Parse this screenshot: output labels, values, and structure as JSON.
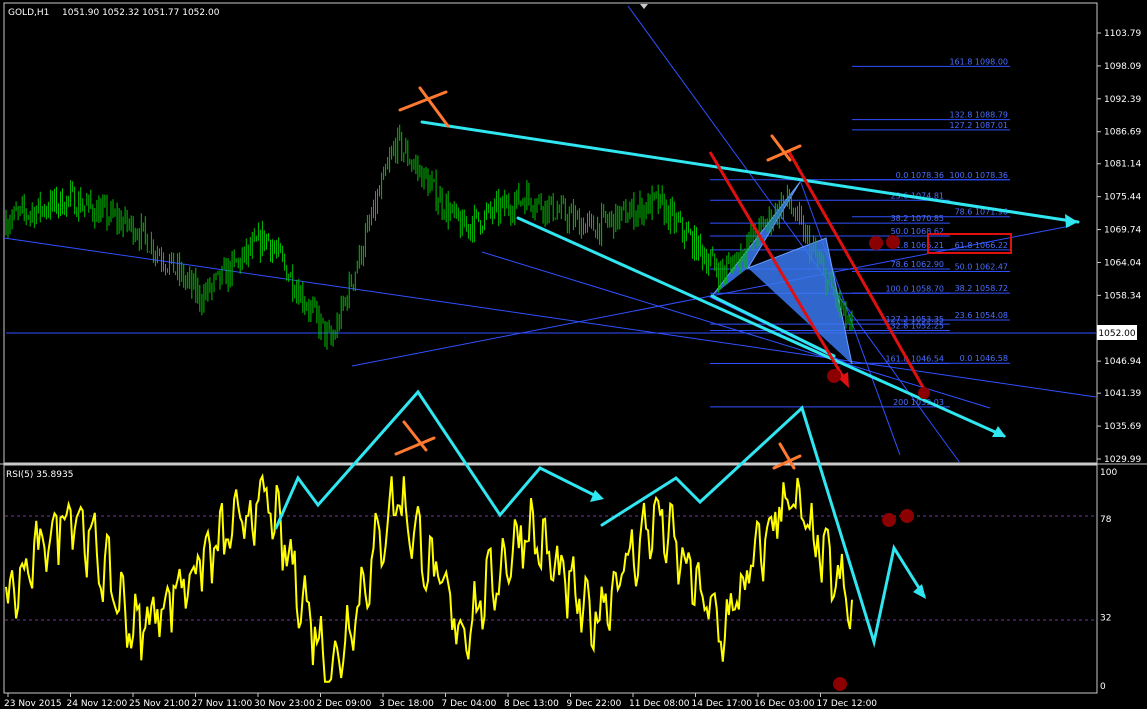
{
  "header": {
    "symbol": "GOLD,H1",
    "ohlc": "1051.90 1052.32 1051.77 1052.00"
  },
  "rsi": {
    "label": "RSI(5) 35.8935",
    "levels": [
      "100",
      "78",
      "32",
      "0"
    ]
  },
  "colors": {
    "background": "#000000",
    "candles": "#00C000",
    "rsi_line": "#FFFF00",
    "trendlines": "#3050FF",
    "cyan_lines": "#30E6F0",
    "red_lines": "#E01010",
    "fib_labels": "#4A6EFF",
    "pattern_fill": "#3A78F0",
    "marker_dots": "#8B0000",
    "orange_marks": "#FF7A30",
    "current_price_box": "#FFFFFF",
    "rsi_levels": "#5A2A8C",
    "axis_text": "#FFFFFF",
    "highlight_box": "#E01010"
  },
  "chart_data": [
    {
      "type": "candlestick",
      "title": "GOLD,H1",
      "y_ticks": [
        "1103.79",
        "1098.09",
        "1092.39",
        "1086.69",
        "1081.14",
        "1075.44",
        "1069.74",
        "1064.04",
        "1058.34",
        "1052.00",
        "1046.94",
        "1041.39",
        "1035.69",
        "1029.99"
      ],
      "current_price": "1052.00",
      "x_ticks": [
        "23 Nov 2015",
        "24 Nov 12:00",
        "25 Nov 21:00",
        "27 Nov 11:00",
        "30 Nov 23:00",
        "2 Dec 09:00",
        "3 Dec 18:00",
        "7 Dec 04:00",
        "8 Dec 13:00",
        "9 Dec 22:00",
        "11 Dec 08:00",
        "14 Dec 17:00",
        "16 Dec 03:00",
        "17 Dec 12:00"
      ],
      "ylim": [
        1029.0,
        1106.0
      ],
      "approx_close_path": [
        {
          "x": "23 Nov 2015",
          "y": 1071.5
        },
        {
          "x": "24 Nov 12:00",
          "y": 1075.0
        },
        {
          "x": "25 Nov 21:00",
          "y": 1070.0
        },
        {
          "x": "27 Nov 11:00",
          "y": 1058.0
        },
        {
          "x": "30 Nov 23:00",
          "y": 1068.5
        },
        {
          "x": "2 Dec 09:00",
          "y": 1050.0
        },
        {
          "x": "3 Dec 18:00",
          "y": 1085.0
        },
        {
          "x": "7 Dec 04:00",
          "y": 1070.0
        },
        {
          "x": "8 Dec 13:00",
          "y": 1075.5
        },
        {
          "x": "9 Dec 22:00",
          "y": 1070.0
        },
        {
          "x": "11 Dec 08:00",
          "y": 1074.5
        },
        {
          "x": "14 Dec 17:00",
          "y": 1062.0
        },
        {
          "x": "16 Dec 03:00",
          "y": 1075.0
        },
        {
          "x": "17 Dec 12:00",
          "y": 1052.0
        }
      ],
      "fib_levels": [
        {
          "label": "161.8 1098.00"
        },
        {
          "label": "132.8 1088.79"
        },
        {
          "label": "127.2 1087.01"
        },
        {
          "label": "0.0 1078.36"
        },
        {
          "label": "100.0 1078.36"
        },
        {
          "label": "23.6 1074.81"
        },
        {
          "label": "78.6 1071.96"
        },
        {
          "label": "38.2 1070.85"
        },
        {
          "label": "50.0 1068.62"
        },
        {
          "label": "61.8 1066.21"
        },
        {
          "label": "61.8 1066.22"
        },
        {
          "label": "78.6 1062.90"
        },
        {
          "label": "50.0 1062.47"
        },
        {
          "label": "100.0 1058.70"
        },
        {
          "label": "38.2 1058.72"
        },
        {
          "label": "127.2 1053.35"
        },
        {
          "label": "23.6 1054.08"
        },
        {
          "label": "132.8 1052.25"
        },
        {
          "label": "161.8 1046.54"
        },
        {
          "label": "0.0 1046.58"
        },
        {
          "label": "200 1039.03"
        }
      ]
    },
    {
      "type": "line",
      "title": "RSI(5) 35.8935",
      "ylim": [
        0,
        100
      ],
      "levels": [
        78,
        32
      ],
      "approx_values": [
        {
          "x": "23 Nov 2015",
          "y": 38
        },
        {
          "x": "24 Nov 12:00",
          "y": 85
        },
        {
          "x": "25 Nov 21:00",
          "y": 25
        },
        {
          "x": "27 Nov 11:00",
          "y": 58
        },
        {
          "x": "30 Nov 23:00",
          "y": 88
        },
        {
          "x": "2 Dec 09:00",
          "y": 5
        },
        {
          "x": "3 Dec 18:00",
          "y": 90
        },
        {
          "x": "7 Dec 04:00",
          "y": 25
        },
        {
          "x": "8 Dec 13:00",
          "y": 75
        },
        {
          "x": "9 Dec 22:00",
          "y": 30
        },
        {
          "x": "11 Dec 08:00",
          "y": 80
        },
        {
          "x": "14 Dec 17:00",
          "y": 25
        },
        {
          "x": "16 Dec 03:00",
          "y": 90
        },
        {
          "x": "17 Dec 12:00",
          "y": 36
        }
      ]
    }
  ]
}
